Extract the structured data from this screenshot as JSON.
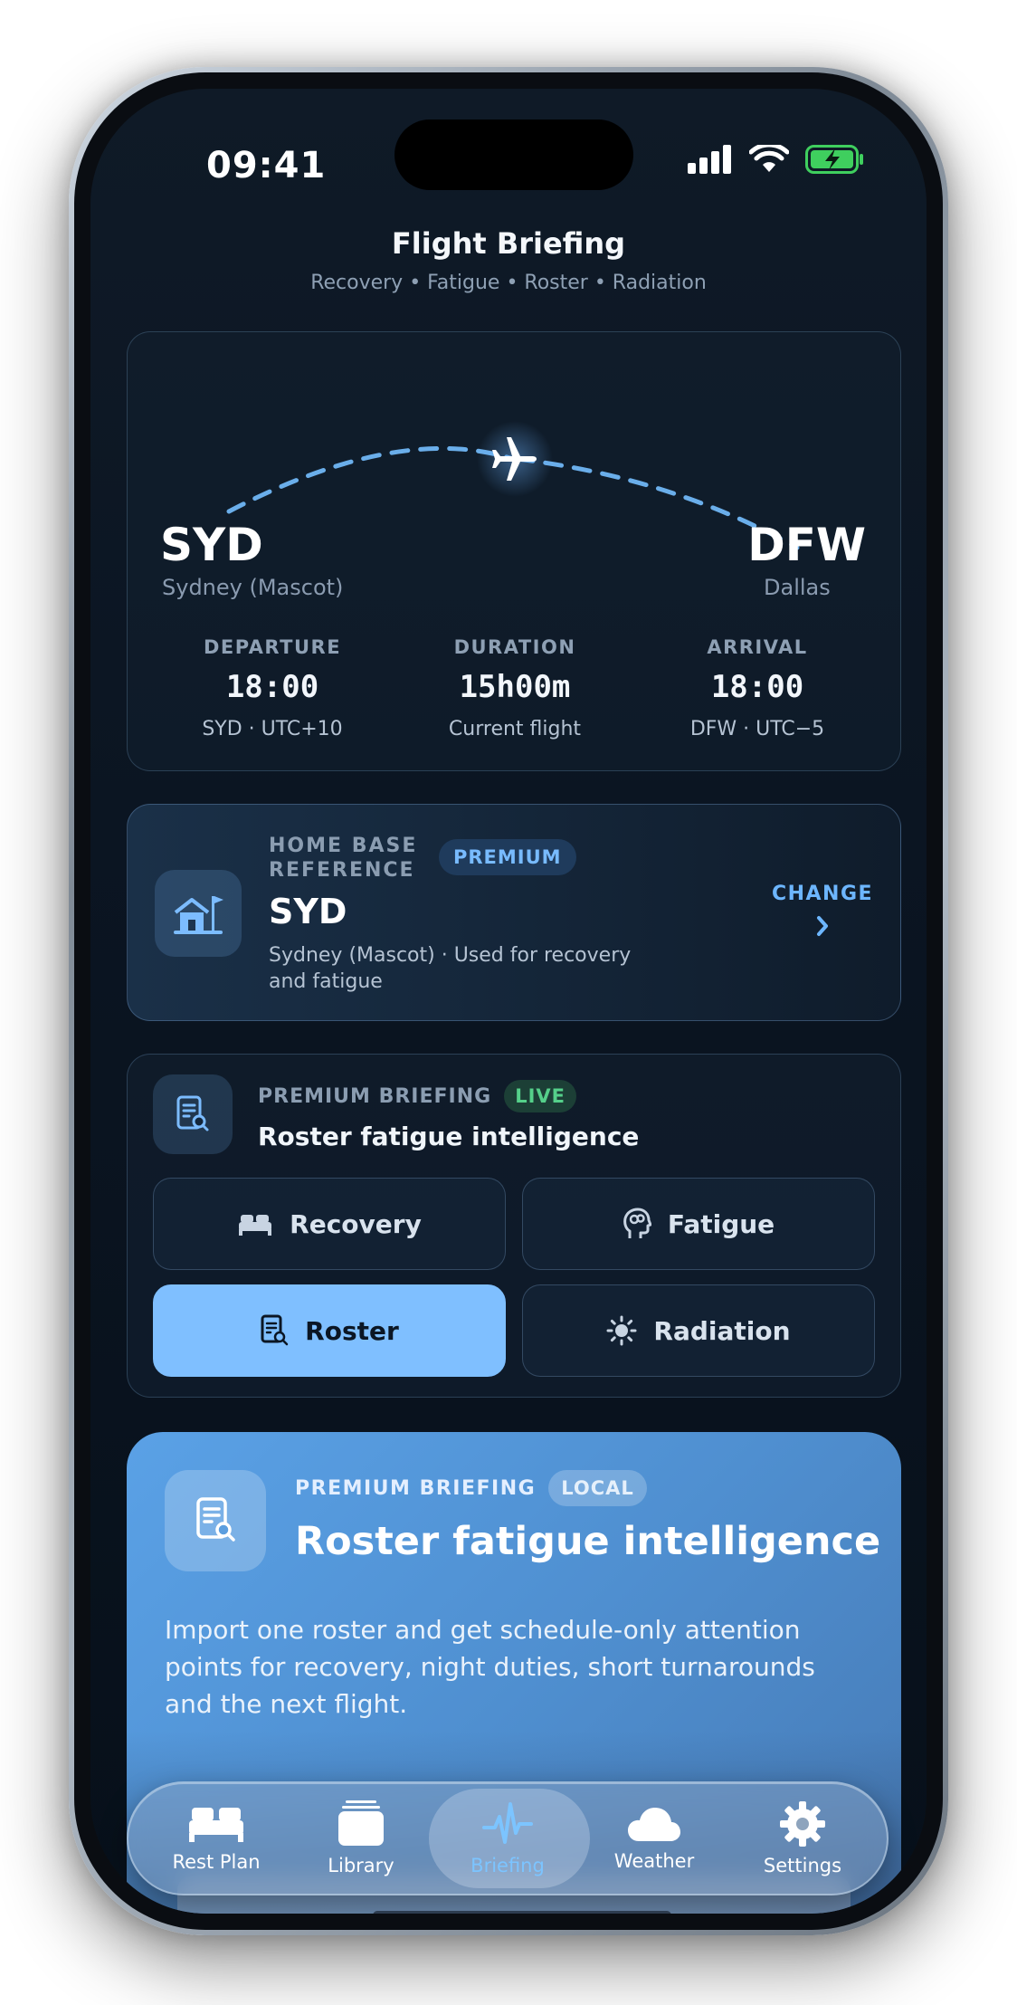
{
  "status_bar": {
    "time": "09:41"
  },
  "header": {
    "title": "Flight Briefing",
    "subtitle": "Recovery • Fatigue • Roster • Radiation"
  },
  "route": {
    "origin": {
      "code": "SYD",
      "city": "Sydney (Mascot)"
    },
    "destination": {
      "code": "DFW",
      "city": "Dallas"
    },
    "departure": {
      "label": "DEPARTURE",
      "time": "18:00",
      "detail": "SYD · UTC+10"
    },
    "duration": {
      "label": "DURATION",
      "value": "15h00m",
      "detail": "Current flight"
    },
    "arrival": {
      "label": "ARRIVAL",
      "time": "18:00",
      "detail": "DFW · UTC−5"
    }
  },
  "home_base": {
    "kicker_line1": "HOME BASE",
    "kicker_line2": "REFERENCE",
    "badge": "PREMIUM",
    "code": "SYD",
    "description_line1": "Sydney (Mascot) · Used for recovery",
    "description_line2": "and fatigue",
    "change_label": "CHANGE"
  },
  "briefing_selector": {
    "kicker": "PREMIUM BRIEFING",
    "badge": "LIVE",
    "title": "Roster fatigue intelligence",
    "segments": [
      {
        "label": "Recovery",
        "icon": "bed-icon",
        "active": false
      },
      {
        "label": "Fatigue",
        "icon": "head-brain-icon",
        "active": false
      },
      {
        "label": "Roster",
        "icon": "roster-document-icon",
        "active": true
      },
      {
        "label": "Radiation",
        "icon": "sun-icon",
        "active": false
      }
    ]
  },
  "briefing_card": {
    "kicker": "PREMIUM BRIEFING",
    "badge": "LOCAL",
    "title": "Roster fatigue intelligence",
    "body_line1": "Import one roster and get schedule-only attention",
    "body_line2": "points for recovery, night duties, short turnarounds",
    "body_line3": "and the next flight."
  },
  "tab_bar": {
    "tabs": [
      {
        "label": "Rest Plan",
        "icon": "bed-icon",
        "active": false
      },
      {
        "label": "Library",
        "icon": "stack-icon",
        "active": false
      },
      {
        "label": "Briefing",
        "icon": "waveform-icon",
        "active": true
      },
      {
        "label": "Weather",
        "icon": "cloud-icon",
        "active": false
      },
      {
        "label": "Settings",
        "icon": "gear-icon",
        "active": false
      }
    ]
  },
  "colors": {
    "accent": "#7FBFFF",
    "live_green": "#55D08A",
    "card_blue": "#5AA1E6",
    "background": "#0B1522"
  }
}
